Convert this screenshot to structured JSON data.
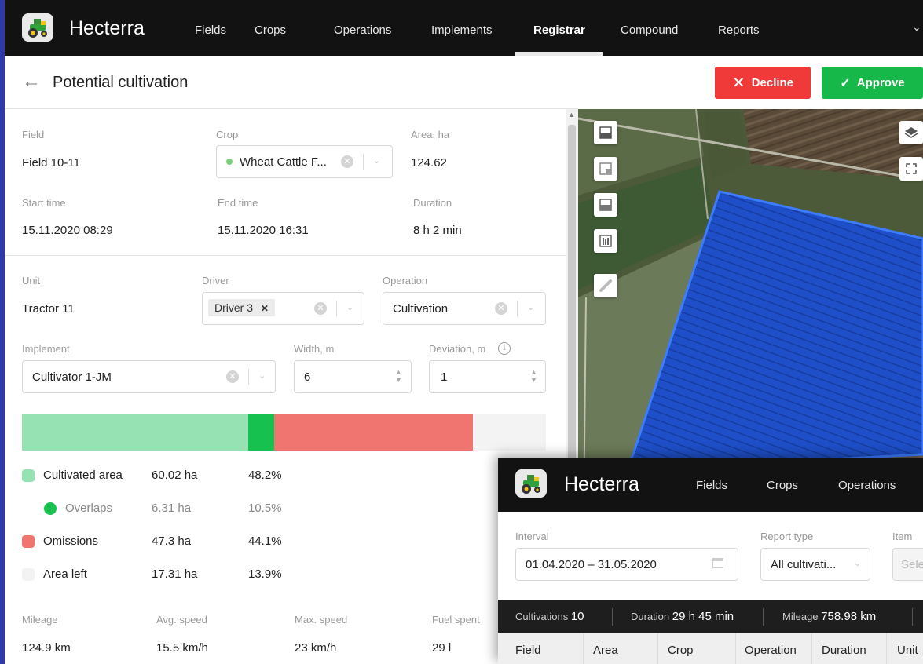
{
  "app": {
    "name": "Hecterra"
  },
  "nav": [
    "Fields",
    "Crops",
    "Operations",
    "Implements",
    "Registrar",
    "Compound",
    "Reports"
  ],
  "header": {
    "title": "Potential cultivation",
    "decline": "Decline",
    "approve": "Approve"
  },
  "form": {
    "field_label": "Field",
    "field_value": "Field 10-11",
    "crop_label": "Crop",
    "crop_value": "Wheat Cattle F...",
    "area_label": "Area, ha",
    "area_value": "124.62",
    "start_label": "Start time",
    "start_value": "15.11.2020 08:29",
    "end_label": "End time",
    "end_value": "15.11.2020 16:31",
    "duration_label": "Duration",
    "duration_value": "8 h 2 min",
    "unit_label": "Unit",
    "unit_value": "Tractor 11",
    "driver_label": "Driver",
    "driver_tag": "Driver 3",
    "operation_label": "Operation",
    "operation_value": "Cultivation",
    "implement_label": "Implement",
    "implement_value": "Cultivator 1-JM",
    "width_label": "Width, m",
    "width_value": "6",
    "deviation_label": "Deviation, m",
    "deviation_value": "1"
  },
  "coverage": {
    "segments": [
      {
        "name": "Cultivated area",
        "fraction": 0.432,
        "color": "#96e2b2"
      },
      {
        "name": "Overlaps",
        "fraction": 0.05,
        "color": "#16c150"
      },
      {
        "name": "Omissions",
        "fraction": 0.38,
        "color": "#f07470"
      },
      {
        "name": "Area left",
        "fraction": 0.138,
        "color": "#f3f3f3"
      }
    ],
    "legend": [
      {
        "label": "Cultivated area",
        "value": "60.02 ha",
        "percent": "48.2%",
        "color": "#96e2b2"
      },
      {
        "label": "Overlaps",
        "value": "6.31 ha",
        "percent": "10.5%",
        "color": "#16c150"
      },
      {
        "label": "Omissions",
        "value": "47.3 ha",
        "percent": "44.1%",
        "color": "#f07470"
      },
      {
        "label": "Area left",
        "value": "17.31 ha",
        "percent": "13.9%",
        "color": "#f3f3f3"
      }
    ]
  },
  "summary": {
    "mileage_label": "Mileage",
    "mileage_value": "124.9 km",
    "avg_label": "Avg. speed",
    "avg_value": "15.5 km/h",
    "max_label": "Max. speed",
    "max_value": "23 km/h",
    "fuel_label": "Fuel spent",
    "fuel_value": "29 l"
  },
  "overlay": {
    "nav": [
      "Fields",
      "Crops",
      "Operations"
    ],
    "interval_label": "Interval",
    "interval_value": "01.04.2020 – 31.05.2020",
    "report_label": "Report type",
    "report_value": "All cultivati...",
    "item_label": "Item",
    "item_placeholder": "Sele",
    "stats": {
      "cult_label": "Cultivations",
      "cult_value": "10",
      "dur_label": "Duration",
      "dur_value": "29 h 45 min",
      "mil_label": "Mileage",
      "mil_value": "758.98 km"
    },
    "columns": [
      "Field",
      "Area",
      "Crop",
      "Operation",
      "Duration",
      "Unit"
    ]
  }
}
